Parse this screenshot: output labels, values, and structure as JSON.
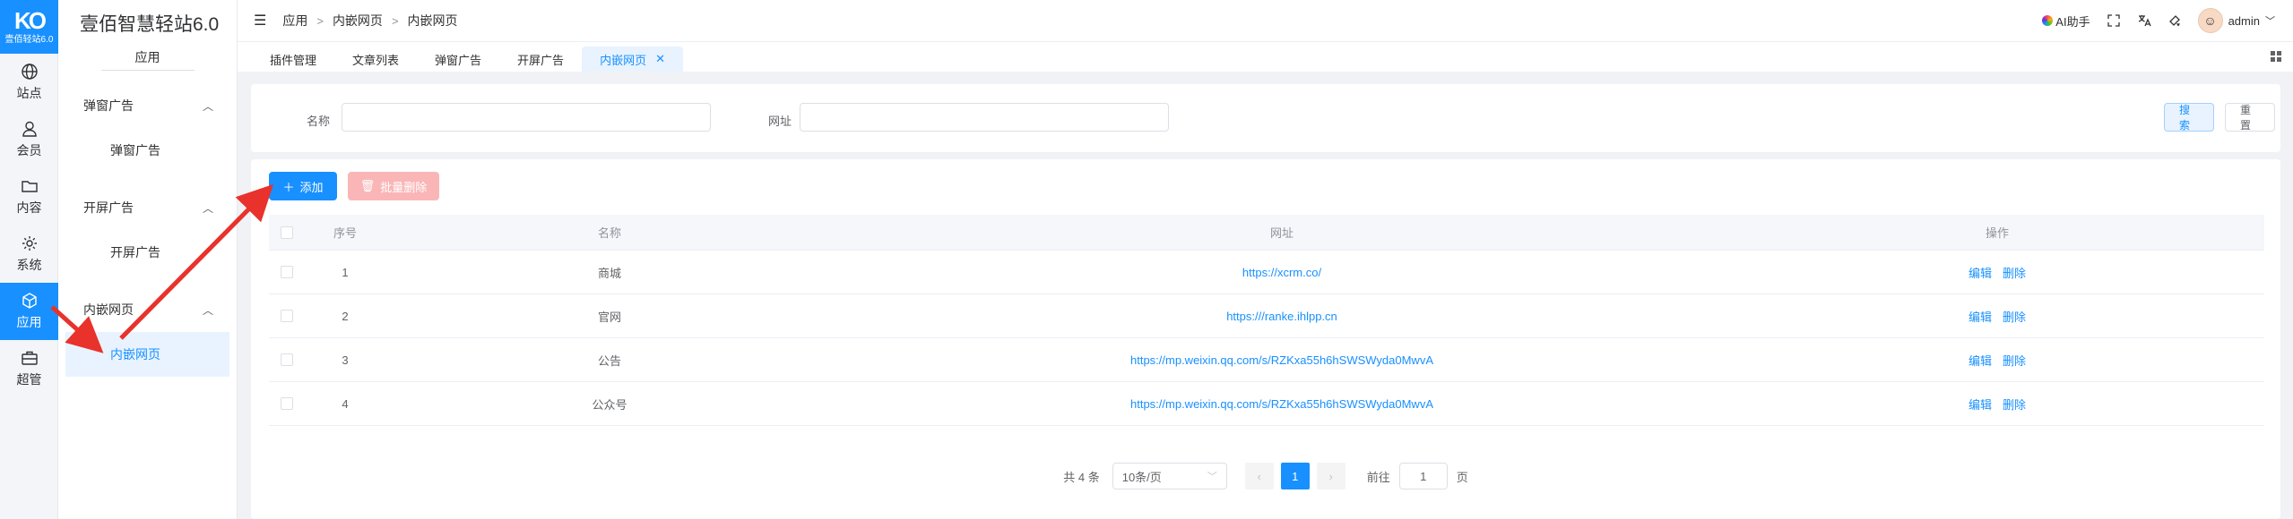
{
  "brand": {
    "logo_mark": "KO",
    "logo_text": "壹佰轻站6.0",
    "site_title": "壹佰智慧轻站6.0"
  },
  "iconbar": [
    {
      "label": "站点",
      "icon": "globe-icon"
    },
    {
      "label": "会员",
      "icon": "user-icon"
    },
    {
      "label": "内容",
      "icon": "folder-icon"
    },
    {
      "label": "系统",
      "icon": "gear-icon"
    },
    {
      "label": "应用",
      "icon": "cube-icon"
    },
    {
      "label": "超管",
      "icon": "briefcase-icon"
    }
  ],
  "sidebar": {
    "section_label": "应用",
    "groups": [
      {
        "title": "弹窗广告",
        "items": [
          "弹窗广告"
        ]
      },
      {
        "title": "开屏广告",
        "items": [
          "开屏广告"
        ]
      },
      {
        "title": "内嵌网页",
        "items": [
          "内嵌网页"
        ]
      }
    ]
  },
  "header": {
    "breadcrumb": [
      "应用",
      "内嵌网页",
      "内嵌网页"
    ],
    "ai_label": "AI助手",
    "user_name": "admin"
  },
  "tabs": [
    {
      "label": "插件管理"
    },
    {
      "label": "文章列表"
    },
    {
      "label": "弹窗广告"
    },
    {
      "label": "开屏广告"
    },
    {
      "label": "内嵌网页",
      "active": true
    }
  ],
  "search": {
    "name_label": "名称",
    "name_value": "",
    "url_label": "网址",
    "url_value": "",
    "search_btn": "搜索",
    "reset_btn": "重置"
  },
  "actions": {
    "add": "添加",
    "batch_delete": "批量删除"
  },
  "table": {
    "columns": [
      "序号",
      "名称",
      "网址",
      "操作"
    ],
    "rows": [
      {
        "no": "1",
        "name": "商城",
        "url": "https://xcrm.co/",
        "edit": "编辑",
        "del": "删除"
      },
      {
        "no": "2",
        "name": "官网",
        "url": "https:///ranke.ihlpp.cn",
        "edit": "编辑",
        "del": "删除"
      },
      {
        "no": "3",
        "name": "公告",
        "url": "https://mp.weixin.qq.com/s/RZKxa55h6hSWSWyda0MwvA",
        "edit": "编辑",
        "del": "删除"
      },
      {
        "no": "4",
        "name": "公众号",
        "url": "https://mp.weixin.qq.com/s/RZKxa55h6hSWSWyda0MwvA",
        "edit": "编辑",
        "del": "删除"
      }
    ]
  },
  "pager": {
    "total": "共 4 条",
    "page_size": "10条/页",
    "current": "1",
    "goto_label": "前往",
    "goto_value": "1",
    "page_unit": "页"
  },
  "colors": {
    "accent": "#1890ff",
    "annotation": "#e8322b"
  }
}
